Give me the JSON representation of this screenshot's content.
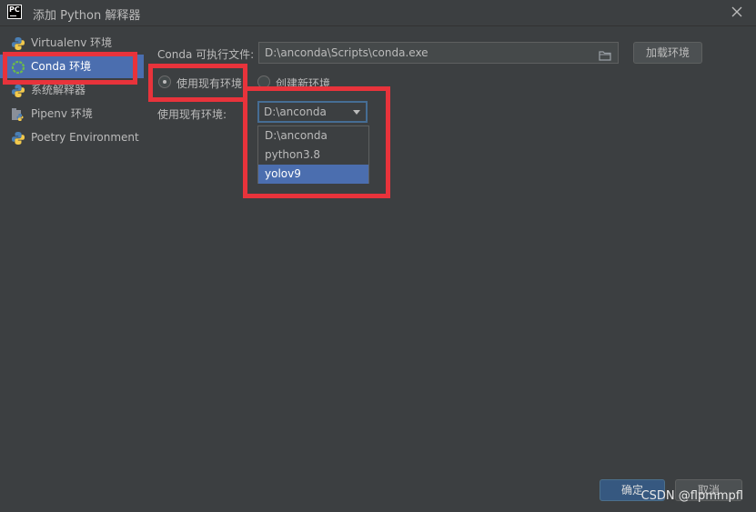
{
  "window": {
    "title": "添加 Python 解释器",
    "app_icon_text": "PC"
  },
  "sidebar": {
    "items": [
      {
        "label": "Virtualenv 环境",
        "icon": "python-icon",
        "selected": false
      },
      {
        "label": "Conda 环境",
        "icon": "conda-icon",
        "selected": true
      },
      {
        "label": "系统解释器",
        "icon": "python-icon",
        "selected": false
      },
      {
        "label": "Pipenv 环境",
        "icon": "pipenv-icon",
        "selected": false
      },
      {
        "label": "Poetry Environment",
        "icon": "python-icon",
        "selected": false
      }
    ]
  },
  "main": {
    "conda_exe_label": "Conda 可执行文件:",
    "conda_exe_value": "D:\\anconda\\Scripts\\conda.exe",
    "load_env_button": "加载环境",
    "radio_use_existing": "使用现有环境",
    "radio_create_new": "创建新环境",
    "use_existing_label": "使用现有环境:",
    "combo_selected": "D:\\anconda",
    "dropdown_options": [
      "D:\\anconda",
      "python3.8",
      "yolov9"
    ],
    "dropdown_highlighted": "yolov9"
  },
  "footer": {
    "ok_button": "确定",
    "cancel_button": "取消",
    "watermark": "CSDN @flpmmpfl"
  },
  "colors": {
    "background": "#3c3f41",
    "selection": "#4b6eaf",
    "annotation_red": "#e8333b",
    "text": "#bbbbbb"
  }
}
